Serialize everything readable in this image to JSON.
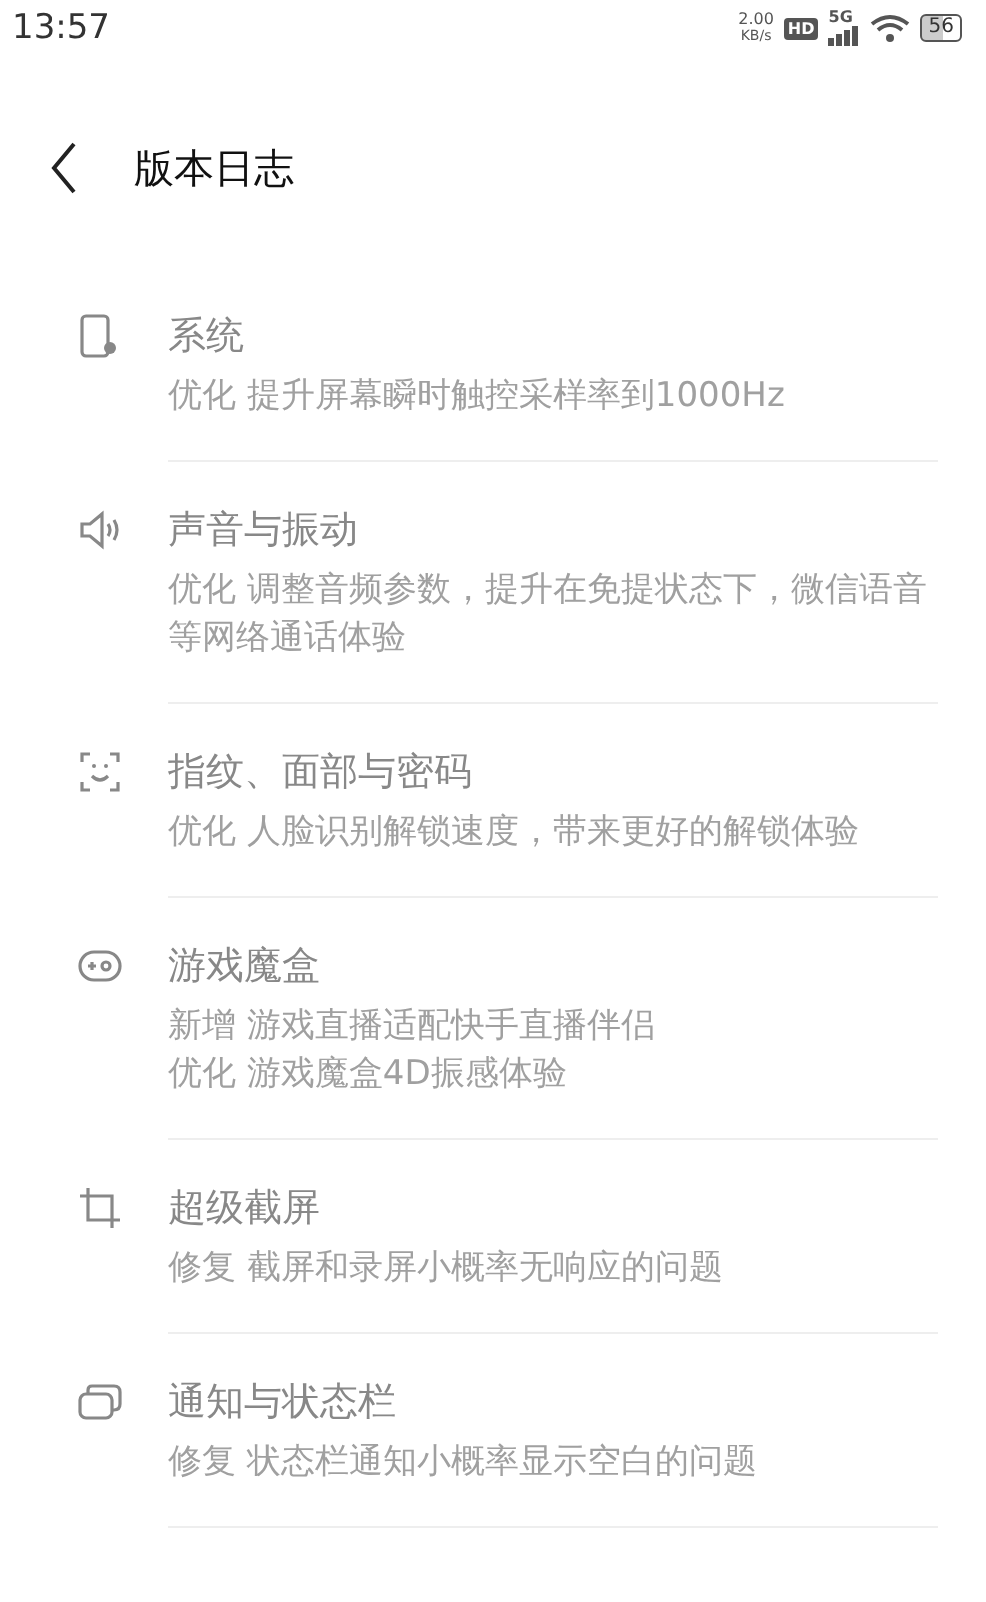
{
  "status_bar": {
    "time": "13:57",
    "speed": "2.00",
    "speed_unit": "KB/s",
    "hd": "HD",
    "network": "5G",
    "battery": "56"
  },
  "header": {
    "title": "版本日志"
  },
  "sections": [
    {
      "title": "系统",
      "lines": [
        "优化 提升屏幕瞬时触控采样率到1000Hz"
      ]
    },
    {
      "title": "声音与振动",
      "lines": [
        "优化 调整音频参数，提升在免提状态下，微信语音等网络通话体验"
      ]
    },
    {
      "title": "指纹、面部与密码",
      "lines": [
        "优化 人脸识别解锁速度，带来更好的解锁体验"
      ]
    },
    {
      "title": "游戏魔盒",
      "lines": [
        "新增 游戏直播适配快手直播伴侣",
        "优化 游戏魔盒4D振感体验"
      ]
    },
    {
      "title": "超级截屏",
      "lines": [
        "修复 截屏和录屏小概率无响应的问题"
      ]
    },
    {
      "title": "通知与状态栏",
      "lines": [
        "修复 状态栏通知小概率显示空白的问题"
      ]
    }
  ]
}
